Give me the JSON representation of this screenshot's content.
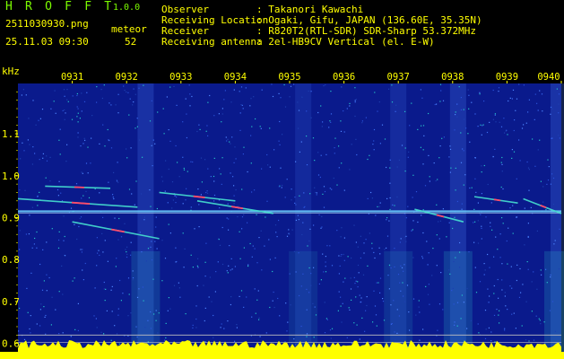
{
  "header": {
    "title": "H R O F F T",
    "version": "1.0.0",
    "filename": "2511030930.png",
    "datetime": "25.11.03 09:30",
    "meteor_label": "meteor",
    "meteor_count": "52",
    "info": [
      {
        "key": "Observer",
        "value": ": Takanori Kawachi"
      },
      {
        "key": "Receiving Location",
        "value": ": Ogaki, Gifu, JAPAN (136.60E, 35.35N)"
      },
      {
        "key": "Receiver",
        "value": ": R820T2(RTL-SDR) SDR-Sharp 53.372MHz"
      },
      {
        "key": "Receiving antenna",
        "value": ": 2el-HB9CV Vertical (el. E-W)"
      }
    ]
  },
  "colors": {
    "background": "#000000",
    "text": "#ffffff",
    "labels": "#ffff00",
    "accent": "#7cfc00",
    "spectrum_base": "#0a1a8c"
  },
  "chart_data": {
    "type": "heatmap",
    "ylabel": "kHz",
    "ylim": [
      0.58,
      1.22
    ],
    "y_ticks": [
      "1.1",
      "1.0",
      "0.9",
      "0.8",
      "0.7",
      "0.6"
    ],
    "y_tick_values": [
      1.1,
      1.0,
      0.9,
      0.8,
      0.7,
      0.6
    ],
    "x_ticks": [
      "0931",
      "0932",
      "0933",
      "0934",
      "0935",
      "0936",
      "0937",
      "0938",
      "0939",
      "0940"
    ],
    "x_range_minutes": [
      0,
      10
    ],
    "grid": false,
    "baseline_kHz": 0.915,
    "meteor_traces": [
      {
        "t0": 0.0,
        "f0": 0.945,
        "t1": 2.2,
        "f1": 0.925
      },
      {
        "t0": 0.5,
        "f0": 0.975,
        "t1": 1.7,
        "f1": 0.97
      },
      {
        "t0": 1.0,
        "f0": 0.89,
        "t1": 2.6,
        "f1": 0.85
      },
      {
        "t0": 2.6,
        "f0": 0.96,
        "t1": 4.0,
        "f1": 0.94
      },
      {
        "t0": 3.3,
        "f0": 0.94,
        "t1": 4.7,
        "f1": 0.91
      },
      {
        "t0": 7.3,
        "f0": 0.92,
        "t1": 8.2,
        "f1": 0.89
      },
      {
        "t0": 8.4,
        "f0": 0.95,
        "t1": 9.2,
        "f1": 0.935
      },
      {
        "t0": 9.3,
        "f0": 0.945,
        "t1": 10.0,
        "f1": 0.91
      }
    ],
    "noise_bands": [
      {
        "t": 2.35,
        "strength": 0.9
      },
      {
        "t": 5.25,
        "strength": 0.6
      },
      {
        "t": 7.0,
        "strength": 0.7
      },
      {
        "t": 8.1,
        "strength": 1.0
      },
      {
        "t": 9.95,
        "strength": 1.0
      }
    ]
  }
}
